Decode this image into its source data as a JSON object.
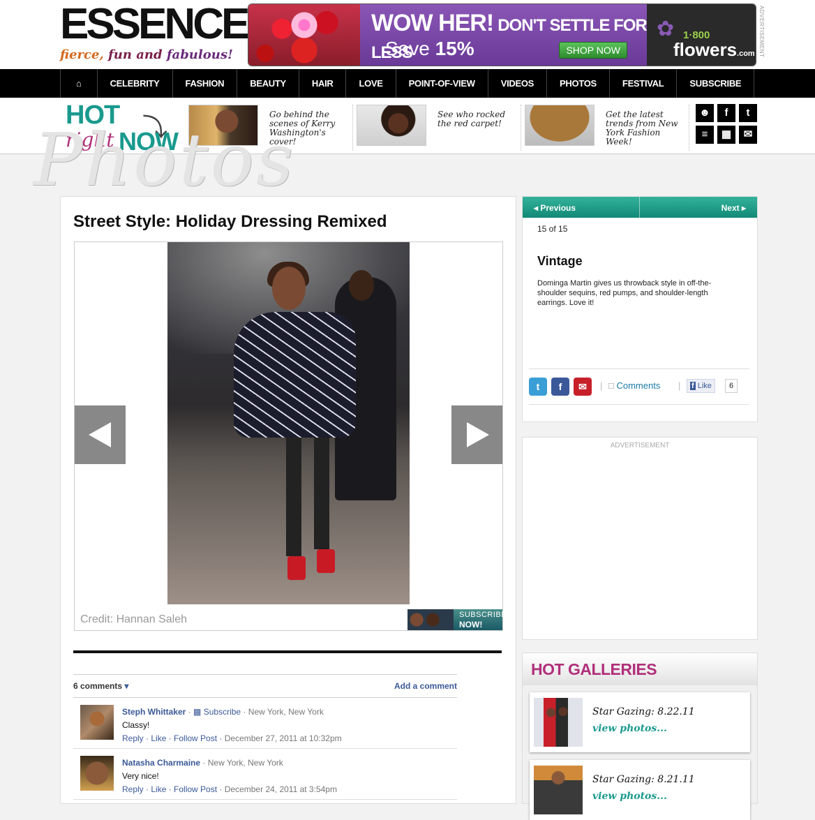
{
  "header": {
    "logo_word": "ESSENCE",
    "logo_tag_1": "fierce,",
    "logo_tag_2": "fun",
    "logo_tag_3": "and",
    "logo_tag_4": "fabulous!",
    "ad": {
      "headline": "WOW HER!",
      "headline_sub": "DON'T SETTLE FOR LESS",
      "save_prefix": "Save",
      "save_value": "15%",
      "cta": "SHOP NOW",
      "brand_num": "1·800",
      "brand_name": "flowers",
      "brand_tld": ".com"
    },
    "ad_label": "ADVERTISEMENT"
  },
  "nav": {
    "items": [
      "CELEBRITY",
      "FASHION",
      "BEAUTY",
      "HAIR",
      "LOVE",
      "POINT-OF-VIEW",
      "VIDEOS",
      "PHOTOS",
      "FESTIVAL",
      "SUBSCRIBE"
    ]
  },
  "hot": {
    "line1": "HOT",
    "line2a": "right",
    "line2b": "NOW",
    "teasers": [
      {
        "text": "Go behind the scenes of Kerry Washington's cover!"
      },
      {
        "text": "See who rocked the red carpet!"
      },
      {
        "text": "Get the latest trends from New York Fashion Week!"
      }
    ]
  },
  "watermark": "Photos",
  "main": {
    "title": "Street Style: Holiday Dressing Remixed",
    "credit": "Credit: Hannan Saleh",
    "subscribe_1": "SUBSCRIBE",
    "subscribe_2": "NOW!"
  },
  "comments": {
    "count": "6 comments",
    "add": "Add a comment",
    "items": [
      {
        "name": "Steph Whittaker",
        "subscribe": "Subscribe",
        "location": "New York, New York",
        "body": "Classy!",
        "reply": "Reply",
        "like": "Like",
        "follow": "Follow Post",
        "date": "December 27, 2011 at 10:32pm"
      },
      {
        "name": "Natasha Charmaine",
        "location": "New York, New York",
        "body": "Very nice!",
        "reply": "Reply",
        "like": "Like",
        "follow": "Follow Post",
        "date": "December 24, 2011 at 3:54pm"
      }
    ]
  },
  "sidebar": {
    "prev": "Previous",
    "next": "Next",
    "count": "15 of 15",
    "subtitle": "Vintage",
    "description": "Dominga Martin gives us throwback style in off-the-shoulder sequins, red pumps, and shoulder-length earrings. Love it!",
    "comments_link": "Comments",
    "like_label": "Like",
    "like_count": "6",
    "ad_label": "ADVERTISEMENT",
    "hot_galleries": "HOT GALLERIES",
    "galleries": [
      {
        "title": "Star Gazing: 8.22.11",
        "link": "view photos..."
      },
      {
        "title": "Star Gazing: 8.21.11",
        "link": "view photos..."
      }
    ]
  },
  "colors": {
    "teal": "#1a9a8e",
    "magenta": "#b0307a",
    "nav_bg": "#000000",
    "facebook_blue": "#3b5998"
  }
}
